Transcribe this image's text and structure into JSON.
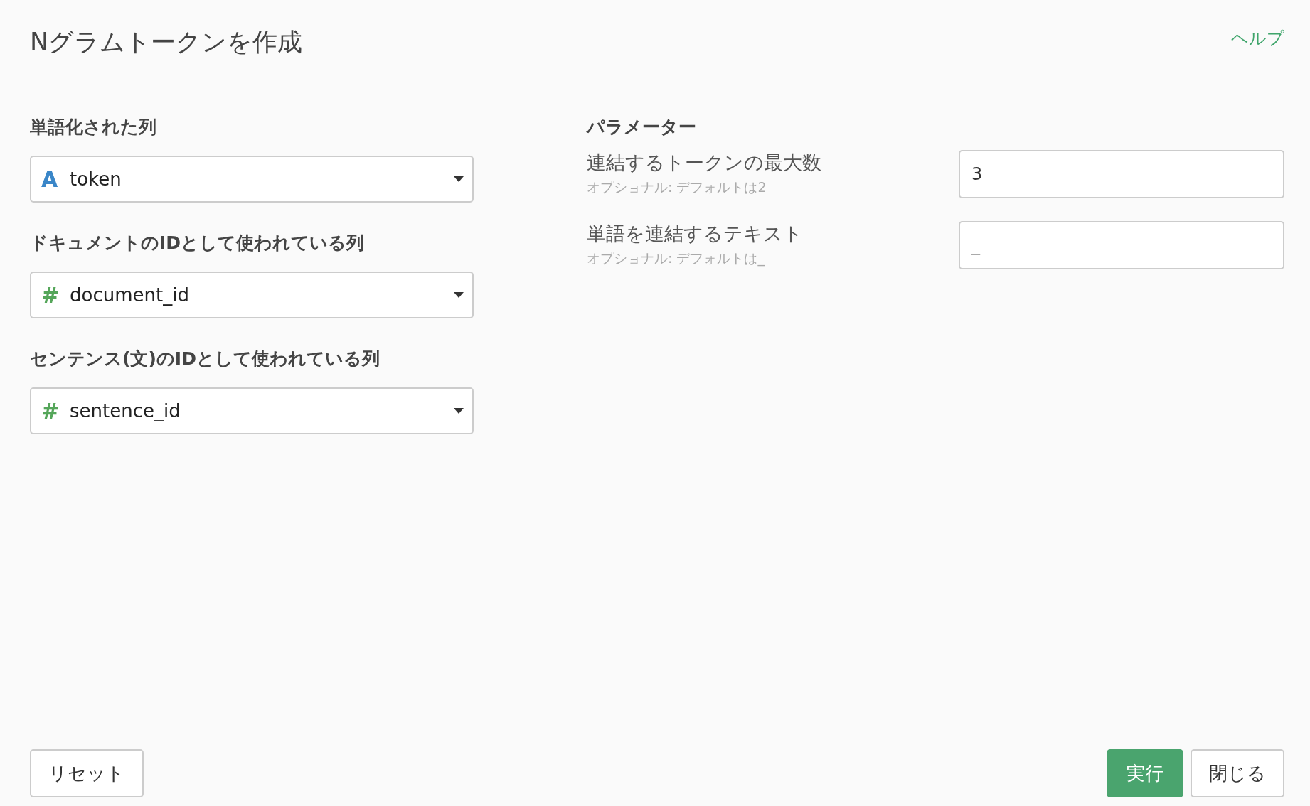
{
  "dialog": {
    "title": "Nグラムトークンを作成",
    "help_link": "ヘルプ"
  },
  "columns": [
    {
      "label": "単語化された列",
      "kind": "text",
      "icon": "A",
      "value": "token"
    },
    {
      "label": "ドキュメントのIDとして使われている列",
      "kind": "numeric",
      "icon": "#",
      "value": "document_id"
    },
    {
      "label": "センテンス(文)のIDとして使われている列",
      "kind": "numeric",
      "icon": "#",
      "value": "sentence_id"
    }
  ],
  "parameters": {
    "heading": "パラメーター",
    "fields": [
      {
        "label": "連結するトークンの最大数",
        "hint": "オプショナル: デフォルトは2",
        "value": "3"
      },
      {
        "label": "単語を連結するテキスト",
        "hint": "オプショナル: デフォルトは_",
        "placeholder": "_"
      }
    ]
  },
  "buttons": {
    "reset": "リセット",
    "run": "実行",
    "close": "閉じる"
  }
}
